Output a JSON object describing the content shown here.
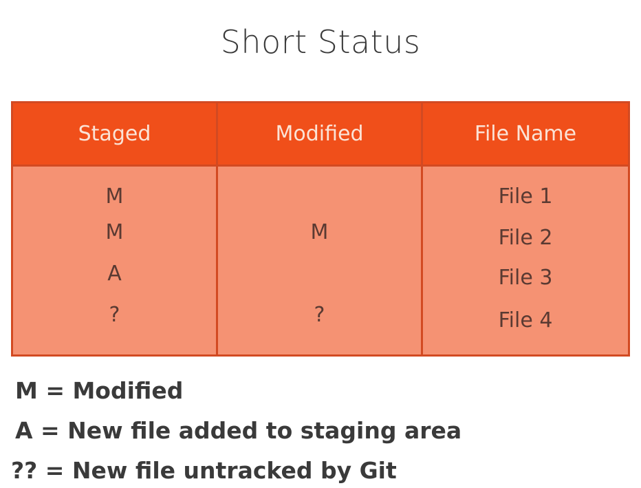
{
  "title": "Short Status",
  "table": {
    "headers": [
      "Staged",
      "Modified",
      "File Name"
    ],
    "rows": [
      {
        "staged": "M",
        "modified": "",
        "file": "File 1"
      },
      {
        "staged": "M",
        "modified": "M",
        "file": "File 2"
      },
      {
        "staged": "A",
        "modified": "",
        "file": "File 3"
      },
      {
        "staged": "?",
        "modified": "?",
        "file": "File 4"
      }
    ]
  },
  "legend": [
    " M = Modified",
    " A = New file added to staging area",
    "?? = New file untracked by Git"
  ],
  "colors": {
    "header_bg": "#f04f1a",
    "body_bg": "#f59273",
    "border": "#d24a22"
  }
}
